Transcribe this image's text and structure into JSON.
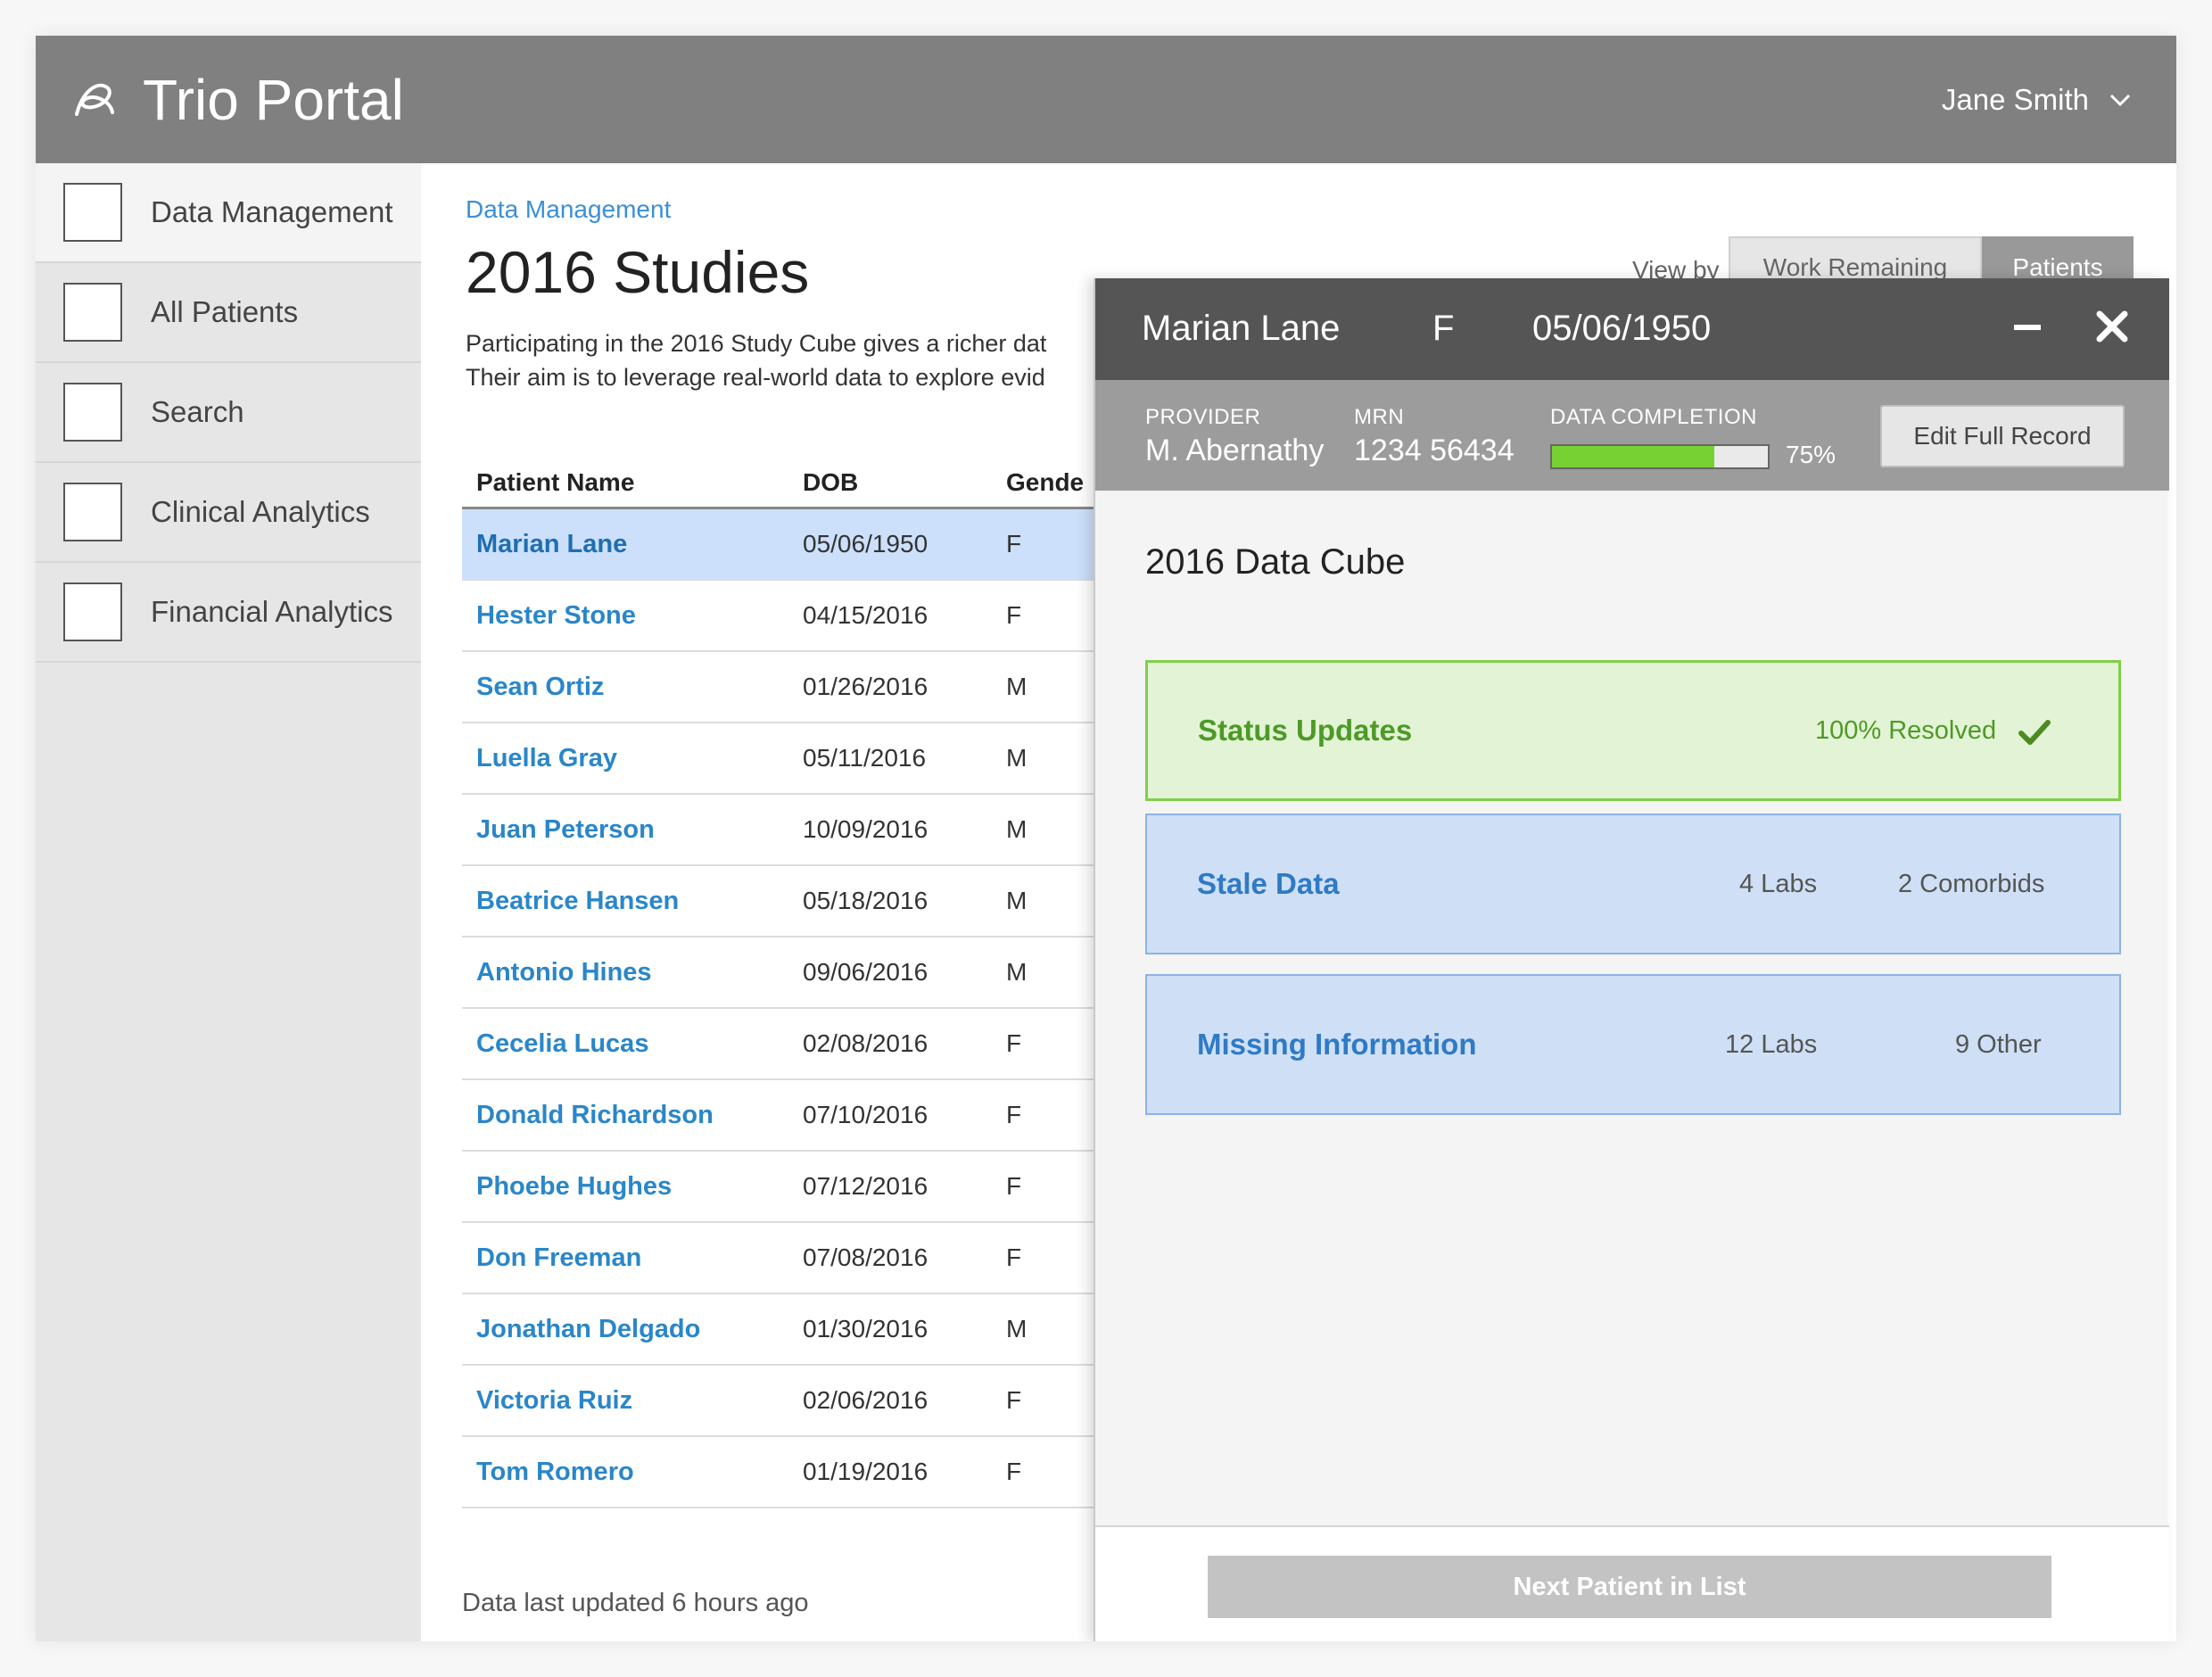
{
  "header": {
    "app_title": "Trio Portal",
    "logo_icon": "trio-logo-icon",
    "user_name": "Jane Smith",
    "user_menu_icon": "chevron-down-icon"
  },
  "sidebar": {
    "items": [
      {
        "label": "Data Management",
        "active": true
      },
      {
        "label": "All Patients",
        "active": false
      },
      {
        "label": "Search",
        "active": false
      },
      {
        "label": "Clinical Analytics",
        "active": false
      },
      {
        "label": "Financial Analytics",
        "active": false
      }
    ]
  },
  "main": {
    "breadcrumb": "Data Management",
    "title": "2016 Studies",
    "description_line1": "Participating in the 2016 Study Cube gives a richer dat",
    "description_line2": "Their aim is to leverage real-world data to explore evid",
    "view_by_label": "View by",
    "toggle": {
      "option_a": "Work Remaining",
      "option_b": "Patients",
      "selected": "Patients"
    },
    "table": {
      "headers": {
        "name": "Patient Name",
        "dob": "DOB",
        "gender": "Gende"
      },
      "rows": [
        {
          "name": "Marian Lane",
          "dob": "05/06/1950",
          "gender": "F",
          "selected": true
        },
        {
          "name": "Hester Stone",
          "dob": "04/15/2016",
          "gender": "F"
        },
        {
          "name": "Sean Ortiz",
          "dob": "01/26/2016",
          "gender": "M"
        },
        {
          "name": "Luella Gray",
          "dob": "05/11/2016",
          "gender": "M"
        },
        {
          "name": "Juan Peterson",
          "dob": "10/09/2016",
          "gender": "M"
        },
        {
          "name": "Beatrice Hansen",
          "dob": "05/18/2016",
          "gender": "M"
        },
        {
          "name": "Antonio Hines",
          "dob": "09/06/2016",
          "gender": "M"
        },
        {
          "name": "Cecelia Lucas",
          "dob": "02/08/2016",
          "gender": "F"
        },
        {
          "name": "Donald Richardson",
          "dob": "07/10/2016",
          "gender": "F"
        },
        {
          "name": "Phoebe Hughes",
          "dob": "07/12/2016",
          "gender": "F"
        },
        {
          "name": "Don Freeman",
          "dob": "07/08/2016",
          "gender": "F"
        },
        {
          "name": "Jonathan Delgado",
          "dob": "01/30/2016",
          "gender": "M"
        },
        {
          "name": "Victoria Ruiz",
          "dob": "02/06/2016",
          "gender": "F"
        },
        {
          "name": "Tom Romero",
          "dob": "01/19/2016",
          "gender": "F"
        }
      ]
    },
    "last_updated": "Data last updated 6 hours ago"
  },
  "drawer": {
    "patient_name": "Marian Lane",
    "gender": "F",
    "dob": "05/06/1950",
    "minimize_icon": "minus-icon",
    "close_icon": "close-icon",
    "provider_label": "PROVIDER",
    "provider_value": "M. Abernathy",
    "mrn_label": "MRN",
    "mrn_value": "1234 56434",
    "completion_label": "DATA COMPLETION",
    "completion_percent": 75,
    "completion_text": "75%",
    "edit_button": "Edit Full Record",
    "section_title": "2016 Data Cube",
    "cards": [
      {
        "title": "Status Updates",
        "stats": [
          "100% Resolved"
        ],
        "status": "resolved",
        "icon": "checkmark-icon"
      },
      {
        "title": "Stale Data",
        "stats": [
          "4 Labs",
          "2 Comorbids"
        ],
        "status": "pending"
      },
      {
        "title": "Missing Information",
        "stats": [
          "12 Labs",
          "9 Other"
        ],
        "status": "pending"
      }
    ],
    "next_button": "Next Patient in List"
  },
  "colors": {
    "header_bg": "#808080",
    "link_blue": "#2a86c9",
    "selected_row": "#cce0fb",
    "progress_green": "#77d132",
    "resolved_green": "#4d9a26",
    "pending_blue": "#2f7ac5"
  }
}
